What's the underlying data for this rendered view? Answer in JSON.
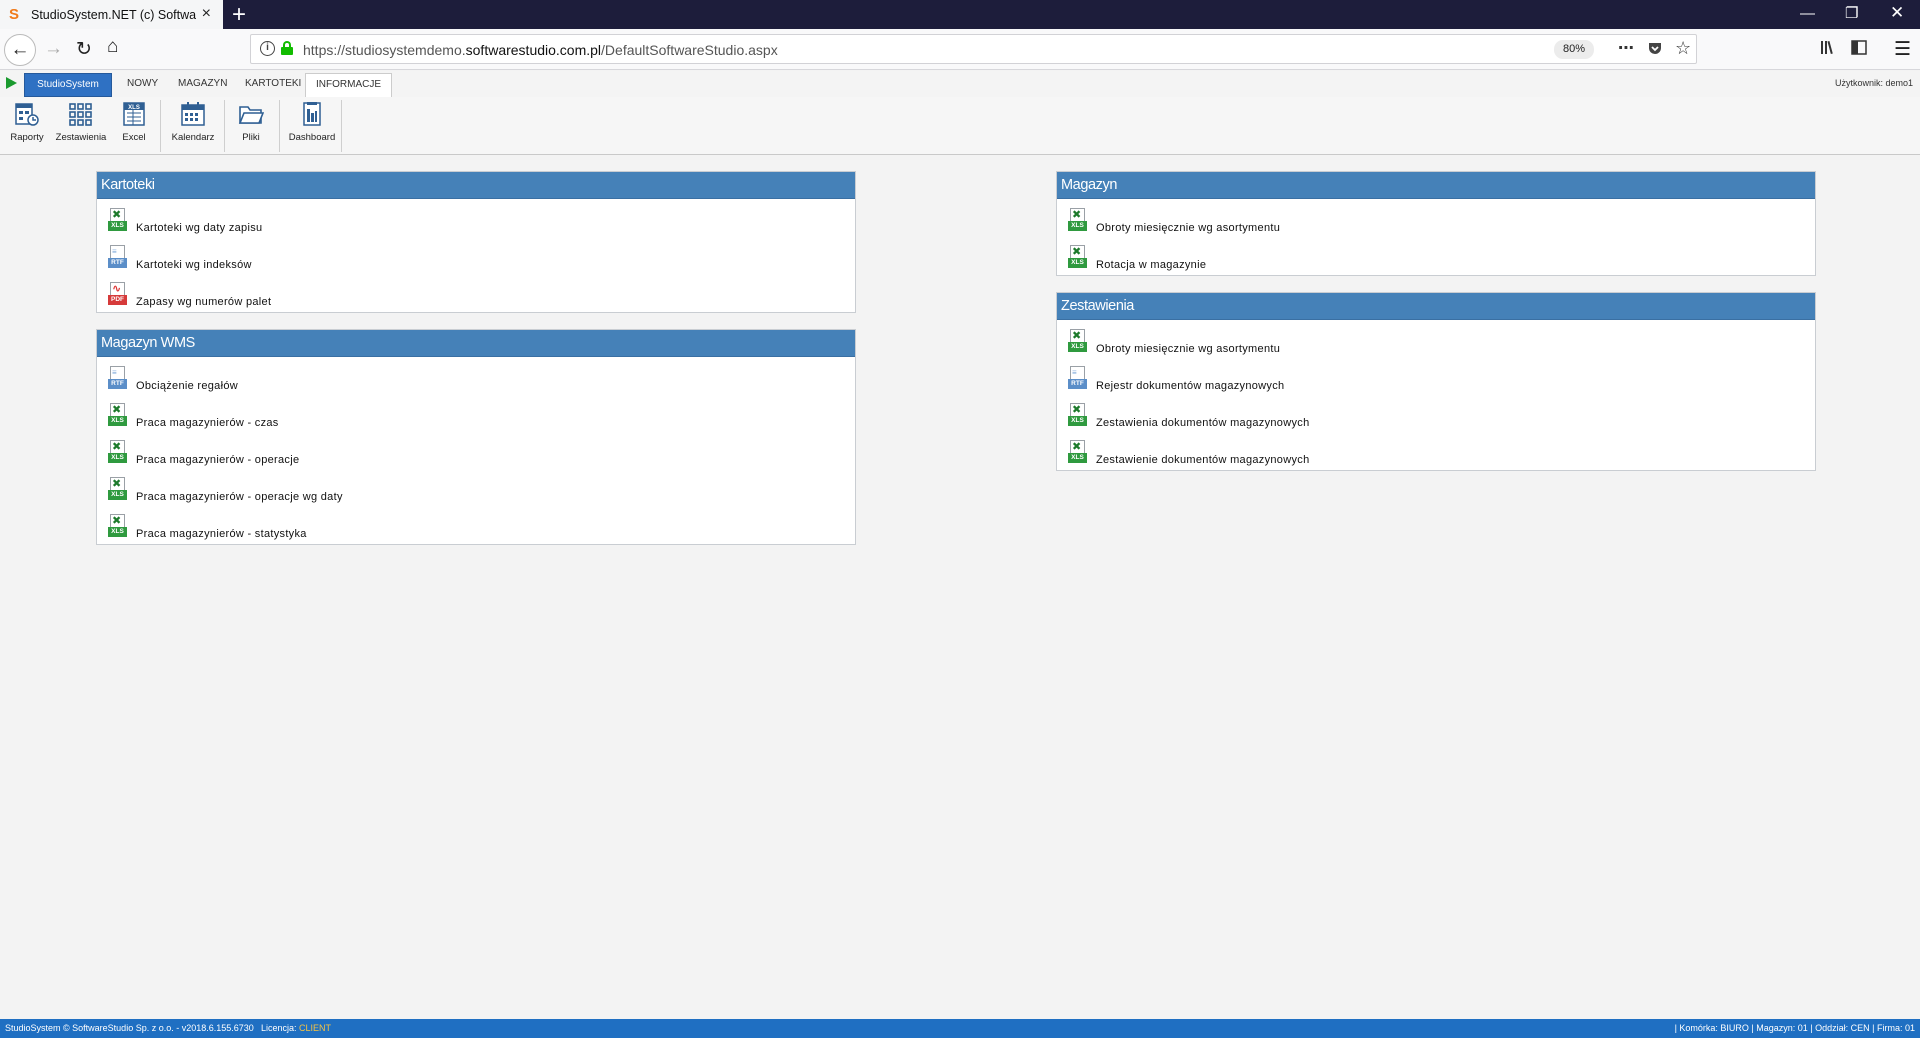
{
  "browser": {
    "tab_title": "StudioSystem.NET (c) Software",
    "tab_close": "×",
    "new_tab": "+",
    "url_prefix": "https://studiosystemdemo.",
    "url_domain": "softwarestudio.com.pl",
    "url_path": "/DefaultSoftwareStudio.aspx",
    "zoom": "80%"
  },
  "app_tabs": {
    "brand": "StudioSystem",
    "items": [
      "NOWY",
      "MAGAZYN",
      "KARTOTEKI",
      "INFORMACJE"
    ],
    "active": "INFORMACJE",
    "user": "Użytkownik: demo1"
  },
  "toolbar": {
    "buttons": [
      {
        "label": "Raporty",
        "icon": "reports-icon"
      },
      {
        "label": "Zestawienia",
        "icon": "grid-icon"
      },
      {
        "label": "Excel",
        "icon": "excel-icon"
      },
      {
        "label": "Kalendarz",
        "icon": "calendar-icon"
      },
      {
        "label": "Pliki",
        "icon": "folder-icon"
      },
      {
        "label": "Dashboard",
        "icon": "dashboard-icon"
      }
    ]
  },
  "panels": {
    "kartoteki": {
      "title": "Kartoteki",
      "items": [
        {
          "label": "Kartoteki wg daty zapisu",
          "type": "xls"
        },
        {
          "label": "Kartoteki wg indeksów",
          "type": "rtf"
        },
        {
          "label": "Zapasy wg numerów palet",
          "type": "pdf"
        }
      ]
    },
    "magazyn_wms": {
      "title": "Magazyn WMS",
      "items": [
        {
          "label": "Obciążenie regałów",
          "type": "rtf"
        },
        {
          "label": "Praca magazynierów - czas",
          "type": "xls"
        },
        {
          "label": "Praca magazynierów - operacje",
          "type": "xls"
        },
        {
          "label": "Praca magazynierów - operacje wg daty",
          "type": "xls"
        },
        {
          "label": "Praca magazynierów - statystyka",
          "type": "xls"
        }
      ]
    },
    "magazyn": {
      "title": "Magazyn",
      "items": [
        {
          "label": "Obroty miesięcznie wg asortymentu",
          "type": "xls"
        },
        {
          "label": "Rotacja w magazynie",
          "type": "xls"
        }
      ]
    },
    "zestawienia": {
      "title": "Zestawienia",
      "items": [
        {
          "label": "Obroty miesięcznie wg asortymentu",
          "type": "xls"
        },
        {
          "label": "Rejestr dokumentów magazynowych",
          "type": "rtf"
        },
        {
          "label": "Zestawienia dokumentów magazynowych",
          "type": "xls"
        },
        {
          "label": "Zestawienie dokumentów magazynowych",
          "type": "xls"
        }
      ]
    }
  },
  "doc_tags": {
    "xls": "XLS",
    "rtf": "RTF",
    "pdf": "PDF"
  },
  "status": {
    "left": "StudioSystem © SoftwareStudio Sp. z o.o. - v2018.6.155.6730",
    "license_label": "Licencja:",
    "license_value": "CLIENT",
    "right": "| Komórka: BIURO | Magazyn: 01 | Oddział: CEN | Firma: 01"
  },
  "colors": {
    "panel_header": "#4581b8",
    "status_bar": "#1f6fc2",
    "brand_tab": "#2f71c3",
    "titlebar": "#1d1d3b"
  }
}
